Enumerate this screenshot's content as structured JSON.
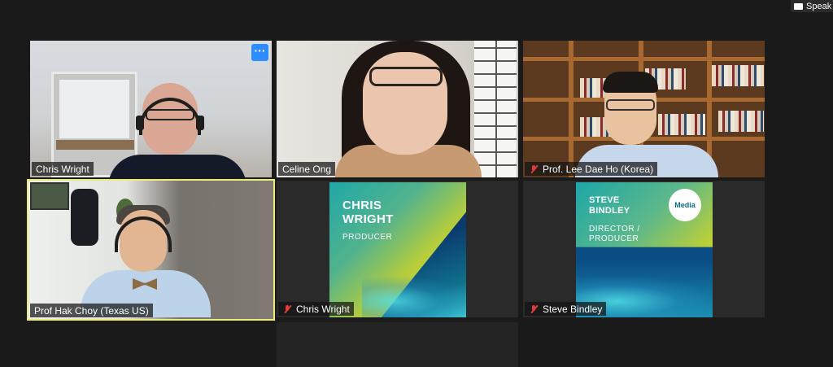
{
  "toolbar": {
    "speaker_view_label": "Speak"
  },
  "tiles": [
    {
      "name": "Chris Wright",
      "muted": false,
      "more_label": "···"
    },
    {
      "name": "Celine Ong",
      "muted": false
    },
    {
      "name": "Prof. Lee Dae Ho (Korea)",
      "muted": true
    },
    {
      "name": "Prof Hak Choy  (Texas US)",
      "muted": false,
      "active_speaker": true
    },
    {
      "name": "Chris Wright",
      "muted": true,
      "card": {
        "name": "CHRIS\nWRIGHT",
        "role": "PRODUCER"
      }
    },
    {
      "name": "Steve Bindley",
      "muted": true,
      "card": {
        "name": "STEVE\nBINDLEY",
        "role": "DIRECTOR /\nPRODUCER",
        "logo": "Media"
      }
    }
  ],
  "colors": {
    "background": "#1a1a1a",
    "active_speaker_outline": "#e9ec7a",
    "muted_icon": "#e03c3c",
    "more_button": "#2d8cff"
  },
  "icons": {
    "muted": "microphone-muted-icon",
    "more": "more-options-icon",
    "speaker_view": "speaker-view-icon"
  }
}
